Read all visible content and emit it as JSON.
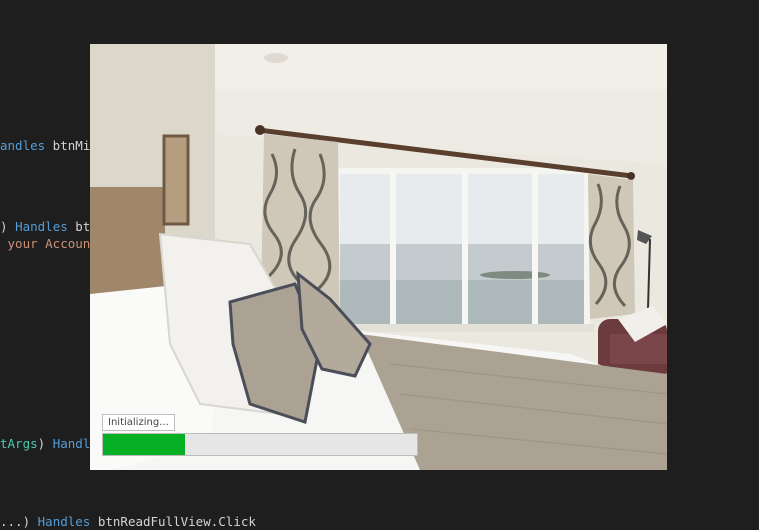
{
  "editor": {
    "line1": {
      "kw": "andles",
      "ident": " btnMin"
    },
    "line2": {
      "pre": ") ",
      "kw": "Handles",
      "ident": " btn"
    },
    "line3": {
      "str": " your Account"
    },
    "line4": {
      "type": "tArgs",
      "mid": ") ",
      "kw": "Handle"
    },
    "line5": {
      "pre": "...) ",
      "kw": "Handles",
      "ident": " btnReadFullView.Click"
    }
  },
  "splash": {
    "status_text": "Initializing...",
    "progress_percent": 26,
    "progress_color": "#06b025"
  }
}
